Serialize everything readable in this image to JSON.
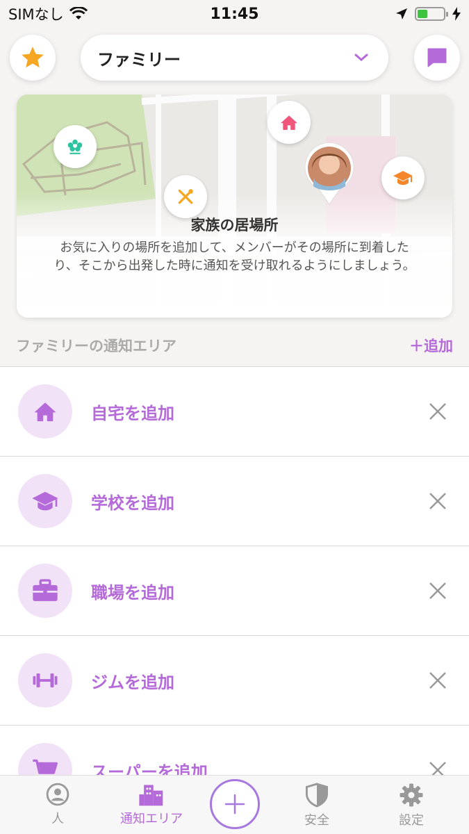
{
  "status_bar": {
    "carrier": "SIMなし",
    "time": "11:45",
    "battery_percent": 40
  },
  "header": {
    "favorite_icon": "star-icon",
    "circle_name": "ファミリー",
    "dropdown_icon": "chevron-down-icon",
    "messages_icon": "chat-bubble-icon"
  },
  "map_card": {
    "title": "家族の居場所",
    "description": "お気に入りの場所を追加して、メンバーがその場所に到着したり、そこから出発した時に通知を受け取れるようにしましょう。",
    "pins": [
      "flower-icon",
      "home-icon",
      "fork-knife-icon",
      "graduation-cap-icon",
      "avatar"
    ]
  },
  "section": {
    "title": "ファミリーの通知エリア",
    "add_label": "＋追加"
  },
  "places": [
    {
      "label": "自宅を追加",
      "icon": "home-icon"
    },
    {
      "label": "学校を追加",
      "icon": "graduation-cap-icon"
    },
    {
      "label": "職場を追加",
      "icon": "briefcase-icon"
    },
    {
      "label": "ジムを追加",
      "icon": "dumbbell-icon"
    },
    {
      "label": "スーパーを追加",
      "icon": "shopping-cart-icon"
    }
  ],
  "tab_bar": {
    "people": "人",
    "places": "通知エリア",
    "safety": "安全",
    "settings": "設定"
  },
  "colors": {
    "accent": "#b46ad8",
    "icon_bg": "#f2e2f8",
    "star": "#f5a623",
    "home_pin": "#f0567a",
    "school_pin": "#f5862a",
    "flower_pin": "#2ec4a0"
  }
}
